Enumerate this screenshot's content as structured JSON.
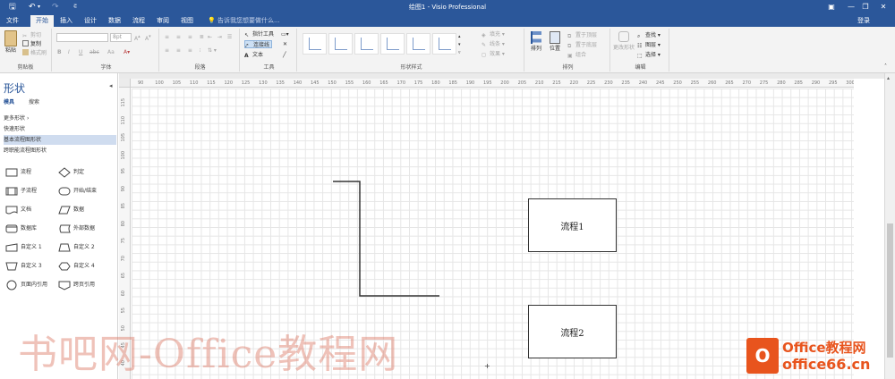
{
  "window": {
    "title": "绘图1 - Visio Professional",
    "buttons": [
      "restore-icon",
      "minimize-icon",
      "maximize-icon",
      "close-icon"
    ]
  },
  "quick_access": [
    "save-icon",
    "undo-icon",
    "redo-icon",
    "customize-icon"
  ],
  "tabs": [
    {
      "label": "文件"
    },
    {
      "label": "开始",
      "active": true
    },
    {
      "label": "插入"
    },
    {
      "label": "设计"
    },
    {
      "label": "数据"
    },
    {
      "label": "流程"
    },
    {
      "label": "审阅"
    },
    {
      "label": "视图"
    }
  ],
  "tellme": "告诉我您想要做什么...",
  "signin": "登录",
  "ribbon": {
    "clipboard": {
      "label": "剪贴板",
      "paste": "粘贴",
      "cut": "剪切",
      "copy": "复制",
      "format_painter": "格式刷"
    },
    "font": {
      "label": "字体",
      "font_size": "8pt",
      "bold": "B",
      "italic": "I",
      "underline": "U",
      "strike": "abc",
      "case": "Aa"
    },
    "paragraph": {
      "label": "段落"
    },
    "tools": {
      "label": "工具",
      "pointer": "指针工具",
      "connector": "连接线",
      "text": "文本"
    },
    "shape_styles": {
      "label": "形状样式",
      "fill": "填充",
      "line": "线条",
      "effects": "效果",
      "count": 6
    },
    "arrange": {
      "label": "排列",
      "align": "排列",
      "position": "位置",
      "bring_front": "置于顶层",
      "send_back": "置于底层",
      "group": "组合"
    },
    "editing": {
      "label": "编辑",
      "change_shape": "更改形状",
      "find": "查找",
      "layers": "图层",
      "select": "选择"
    }
  },
  "shapes_pane": {
    "title": "形状",
    "tabs": [
      "模具",
      "搜索"
    ],
    "links": [
      "更多形状",
      "快速形状",
      "基本流程图形状",
      "跨职能流程图形状"
    ],
    "selected_link": 2,
    "stencils": [
      {
        "label": "流程",
        "shape": "rect"
      },
      {
        "label": "判定",
        "shape": "diamond"
      },
      {
        "label": "子流程",
        "shape": "subprocess"
      },
      {
        "label": "开始/结束",
        "shape": "terminator"
      },
      {
        "label": "文档",
        "shape": "document"
      },
      {
        "label": "数据",
        "shape": "parallelogram"
      },
      {
        "label": "数据库",
        "shape": "database"
      },
      {
        "label": "外部数据",
        "shape": "external"
      },
      {
        "label": "自定义 1",
        "shape": "custom1"
      },
      {
        "label": "自定义 2",
        "shape": "custom2"
      },
      {
        "label": "自定义 3",
        "shape": "custom3"
      },
      {
        "label": "自定义 4",
        "shape": "custom4"
      },
      {
        "label": "页面内引用",
        "shape": "circle"
      },
      {
        "label": "跨页引用",
        "shape": "offpage"
      }
    ]
  },
  "ruler": {
    "h_ticks": [
      "90",
      "100",
      "105",
      "110",
      "115",
      "120",
      "125",
      "130",
      "135",
      "140",
      "145",
      "150",
      "155",
      "160",
      "165",
      "170",
      "175",
      "180",
      "185",
      "190",
      "195",
      "200",
      "205",
      "210",
      "215",
      "220",
      "225",
      "230",
      "235",
      "240",
      "245",
      "250",
      "255",
      "260",
      "265",
      "270",
      "275",
      "280",
      "285",
      "290",
      "295",
      "300"
    ],
    "v_ticks": [
      "115",
      "110",
      "105",
      "100",
      "95",
      "90",
      "85",
      "80",
      "75",
      "70",
      "65",
      "60",
      "55",
      "50",
      "45",
      "40"
    ]
  },
  "canvas": {
    "process1": "流程1",
    "process2": "流程2"
  },
  "watermark": {
    "text": "书吧网-Office教程网",
    "logo_line1": "Office教程网",
    "logo_line2": "office66.cn"
  }
}
